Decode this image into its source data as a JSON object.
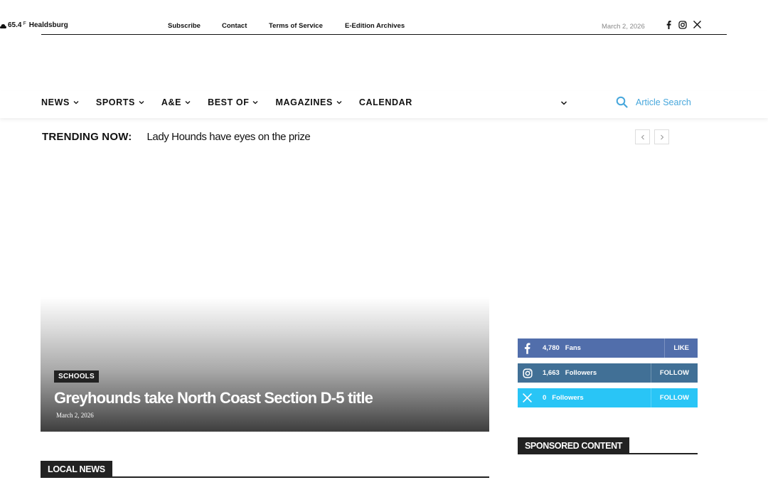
{
  "weather": {
    "temp": "65.4",
    "unit": "F",
    "location": "Healdsburg"
  },
  "top_links": [
    "Subscribe",
    "Contact",
    "Terms of Service",
    "E-Edition Archives"
  ],
  "top_date": "March 2, 2026",
  "top_social_icons": [
    "facebook-icon",
    "instagram-icon",
    "x-icon"
  ],
  "nav": {
    "items": [
      {
        "label": "NEWS",
        "has_dropdown": true
      },
      {
        "label": "SPORTS",
        "has_dropdown": true
      },
      {
        "label": "A&E",
        "has_dropdown": true
      },
      {
        "label": "BEST OF",
        "has_dropdown": true
      },
      {
        "label": "MAGAZINES",
        "has_dropdown": true
      },
      {
        "label": "CALENDAR",
        "has_dropdown": false
      }
    ],
    "search_label": "Article Search"
  },
  "trending": {
    "label": "TRENDING NOW:",
    "headline": "Lady Hounds have eyes on the prize"
  },
  "hero": {
    "category": "SCHOOLS",
    "title": "Greyhounds take North Coast Section D-5 title",
    "date": "March 2, 2026"
  },
  "local_news": {
    "label": "LOCAL NEWS"
  },
  "social_counters": {
    "facebook": {
      "count": "4,780",
      "unit": "Fans",
      "action": "LIKE",
      "color": "#516eab"
    },
    "instagram": {
      "count": "1,663",
      "unit": "Followers",
      "action": "FOLLOW",
      "color": "#417096"
    },
    "x": {
      "count": "0",
      "unit": "Followers",
      "action": "FOLLOW",
      "color": "#29c5f6"
    }
  },
  "sponsored": {
    "label": "SPONSORED CONTENT"
  },
  "colors": {
    "accent": "#47a7dc",
    "dark": "#222222"
  }
}
